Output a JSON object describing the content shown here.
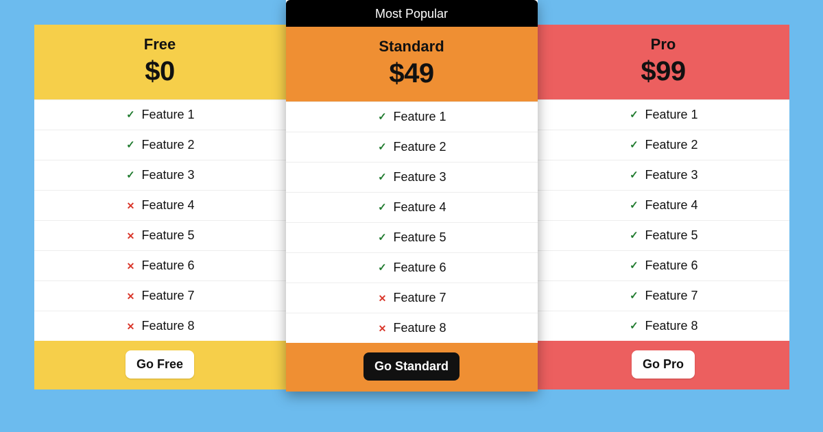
{
  "badge_label": "Most Popular",
  "feature_labels": [
    "Feature 1",
    "Feature 2",
    "Feature 3",
    "Feature 4",
    "Feature 5",
    "Feature 6",
    "Feature 7",
    "Feature 8"
  ],
  "colors": {
    "free": "#f6cf4a",
    "standard": "#ef8f33",
    "pro": "#ec5f5f",
    "check": "#1f7a2e",
    "cross": "#d9362a",
    "page_bg": "#6cbbee"
  },
  "plans": [
    {
      "id": "free",
      "name": "Free",
      "price": "$0",
      "popular": false,
      "cta_label": "Go Free",
      "cta_style": "light",
      "features": [
        true,
        true,
        true,
        false,
        false,
        false,
        false,
        false
      ]
    },
    {
      "id": "standard",
      "name": "Standard",
      "price": "$49",
      "popular": true,
      "cta_label": "Go Standard",
      "cta_style": "dark",
      "features": [
        true,
        true,
        true,
        true,
        true,
        true,
        false,
        false
      ]
    },
    {
      "id": "pro",
      "name": "Pro",
      "price": "$99",
      "popular": false,
      "cta_label": "Go Pro",
      "cta_style": "light",
      "features": [
        true,
        true,
        true,
        true,
        true,
        true,
        true,
        true
      ]
    }
  ]
}
